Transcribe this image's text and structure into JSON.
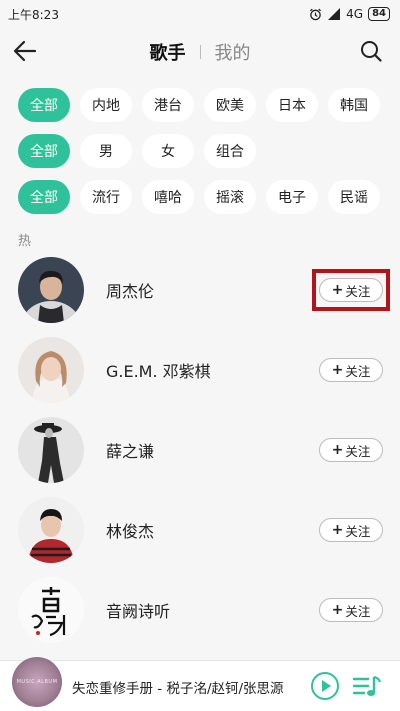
{
  "status_bar": {
    "time": "上午8:23",
    "network": "4G",
    "battery": "84"
  },
  "header": {
    "tabs": [
      {
        "label": "歌手",
        "active": true
      },
      {
        "label": "我的",
        "active": false
      }
    ]
  },
  "filters": {
    "region": [
      "全部",
      "内地",
      "港台",
      "欧美",
      "日本",
      "韩国"
    ],
    "gender": [
      "全部",
      "男",
      "女",
      "组合"
    ],
    "genre": [
      "全部",
      "流行",
      "嘻哈",
      "摇滚",
      "电子",
      "民谣"
    ]
  },
  "section_label": "热",
  "follow_label": "关注",
  "artists": [
    {
      "name": "周杰伦"
    },
    {
      "name": "G.E.M. 邓紫棋"
    },
    {
      "name": "薛之谦"
    },
    {
      "name": "林俊杰"
    },
    {
      "name": "音阙诗听"
    }
  ],
  "player": {
    "track": "失恋重修手册 - 税子洺/赵钶/张思源",
    "cover_text": "MUSIC ALBUM"
  },
  "colors": {
    "accent": "#2fc29a",
    "highlight": "#b1141a"
  }
}
